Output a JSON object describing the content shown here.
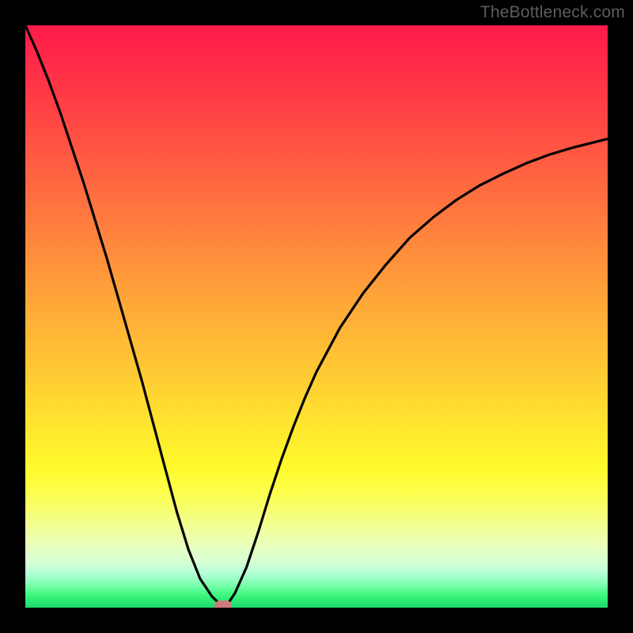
{
  "watermark": "TheBottleneck.com",
  "chart_data": {
    "type": "line",
    "title": "",
    "xlabel": "",
    "ylabel": "",
    "xlim": [
      0,
      100
    ],
    "ylim": [
      0,
      100
    ],
    "grid": false,
    "series": [
      {
        "name": "bottleneck-curve",
        "x": [
          0,
          2,
          4,
          6,
          8,
          10,
          12,
          14,
          16,
          18,
          20,
          22,
          24,
          26,
          28,
          30,
          32,
          33,
          34,
          35,
          36,
          38,
          40,
          42,
          44,
          46,
          48,
          50,
          54,
          58,
          62,
          66,
          70,
          74,
          78,
          82,
          86,
          90,
          94,
          98,
          100
        ],
        "y": [
          100,
          95.5,
          90.5,
          85,
          79,
          73,
          66.5,
          60,
          53,
          46,
          39,
          31.5,
          24,
          16.5,
          10,
          5,
          2,
          1,
          0.5,
          1,
          2.5,
          7,
          13,
          19.5,
          25.5,
          31,
          36,
          40.5,
          48,
          54,
          59,
          63.5,
          67,
          70,
          72.5,
          74.5,
          76.3,
          77.8,
          79,
          80,
          80.5
        ]
      }
    ],
    "marker": {
      "x": 34,
      "y": 0,
      "color": "#cd7a7d"
    },
    "background": {
      "type": "vertical-gradient",
      "stops": [
        {
          "pos": 0,
          "color": "#ff1a4a"
        },
        {
          "pos": 50,
          "color": "#ffb037"
        },
        {
          "pos": 78,
          "color": "#fffe2c"
        },
        {
          "pos": 100,
          "color": "#1cda6a"
        }
      ]
    }
  }
}
